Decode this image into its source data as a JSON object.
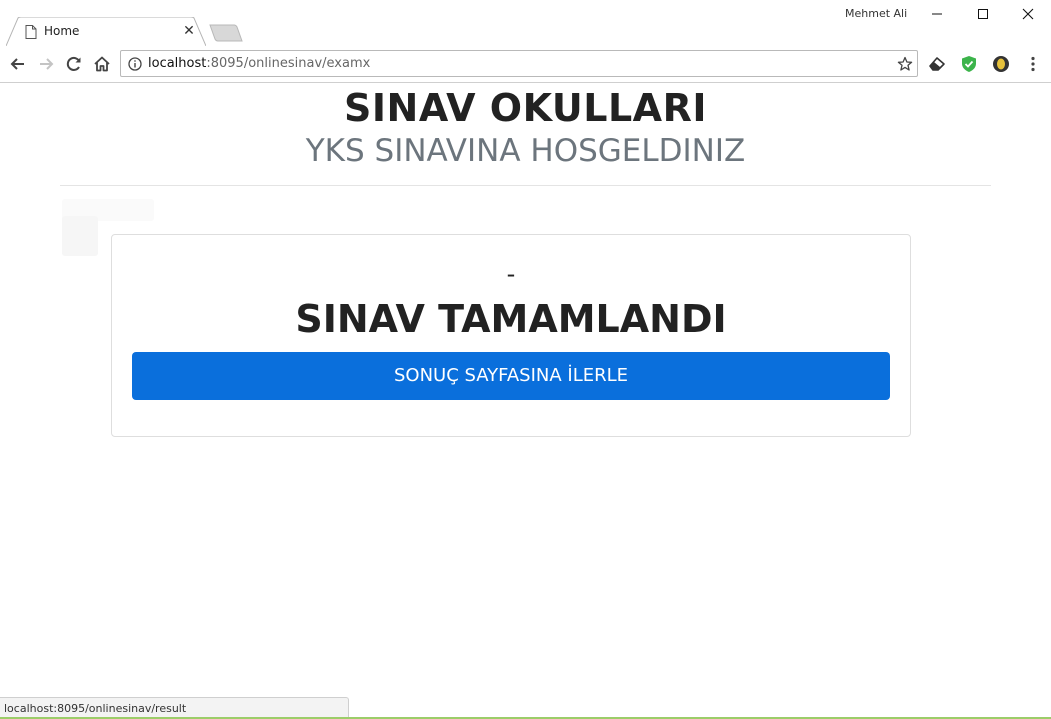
{
  "browser": {
    "tab": {
      "title": "Home",
      "close_glyph": "✕"
    },
    "profile_name": "Mehmet Ali",
    "address": {
      "host": "localhost",
      "path": ":8095/onlinesinav/examx"
    },
    "icons": [
      "back-arrow-icon",
      "forward-arrow-icon",
      "reload-icon",
      "home-icon",
      "info-icon",
      "star-icon",
      "eraser-icon",
      "shield-icon",
      "coin-icon",
      "menu-icon"
    ]
  },
  "header": {
    "title": "SINAV OKULLARI",
    "subtitle": "YKS SINAVINA HOSGELDINIZ"
  },
  "card": {
    "dash": "-",
    "heading": "SINAV TAMAMLANDI",
    "button_label": "SONUÇ SAYFASINA İLERLE"
  },
  "status_bar": {
    "url": "localhost:8095/onlinesinav/result"
  },
  "colors": {
    "primary_button": "#0a6fdc",
    "subtitle": "#6c757d",
    "shield_green": "#3cb44b"
  }
}
